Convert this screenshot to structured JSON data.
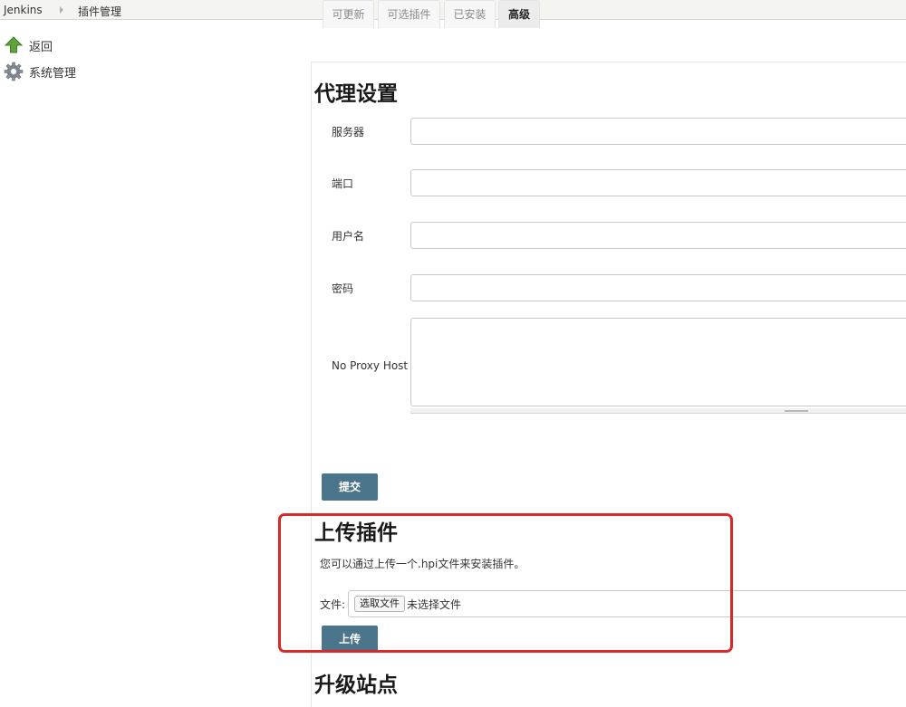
{
  "breadcrumb": {
    "home": "Jenkins",
    "current": "插件管理"
  },
  "sidebar": {
    "items": [
      {
        "label": "返回",
        "icon": "up-arrow-icon"
      },
      {
        "label": "系统管理",
        "icon": "gear-icon"
      }
    ]
  },
  "tabs": [
    "可更新",
    "可选插件",
    "已安装",
    "高级"
  ],
  "active_tab": "高级",
  "proxy": {
    "title": "代理设置",
    "fields": {
      "server": {
        "label": "服务器",
        "value": ""
      },
      "port": {
        "label": "端口",
        "value": ""
      },
      "username": {
        "label": "用户名",
        "value": ""
      },
      "password": {
        "label": "密码",
        "value": ""
      },
      "no_proxy_host": {
        "label": "No Proxy Host",
        "value": ""
      }
    },
    "submit_label": "提交"
  },
  "upload": {
    "title": "上传插件",
    "description": "您可以通过上传一个.hpi文件来安装插件。",
    "file_label": "文件:",
    "choose_button": "选取文件",
    "file_status": "未选择文件",
    "upload_label": "上传"
  },
  "update_site": {
    "title": "升级站点"
  },
  "colors": {
    "button": "#4b758b",
    "highlight": "#d92a2a",
    "up_arrow": "#5fa33a"
  }
}
